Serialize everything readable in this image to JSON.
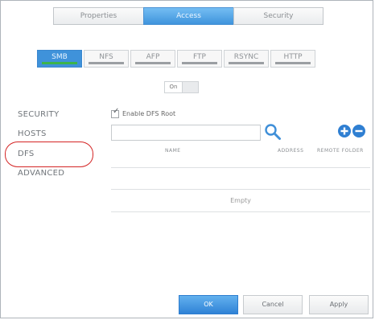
{
  "top_tabs": [
    {
      "label": "Properties",
      "active": false
    },
    {
      "label": "Access",
      "active": true
    },
    {
      "label": "Security",
      "active": false
    }
  ],
  "protocol_tabs": [
    {
      "label": "SMB",
      "active": true
    },
    {
      "label": "NFS",
      "active": false
    },
    {
      "label": "AFP",
      "active": false
    },
    {
      "label": "FTP",
      "active": false
    },
    {
      "label": "RSYNC",
      "active": false
    },
    {
      "label": "HTTP",
      "active": false
    }
  ],
  "toggle": {
    "label": "On",
    "state": "on"
  },
  "menu": [
    {
      "label": "SECURITY",
      "selected": false
    },
    {
      "label": "HOSTS",
      "selected": false
    },
    {
      "label": "DFS",
      "selected": true
    },
    {
      "label": "ADVANCED",
      "selected": false
    }
  ],
  "dfs": {
    "enable_label": "Enable DFS Root",
    "enable_checked": true,
    "search_value": "",
    "search_icon": "magnifier-icon",
    "add_icon": "plus-circle-icon",
    "remove_icon": "minus-circle-icon",
    "columns": [
      "NAME",
      "ADDRESS",
      "REMOTE FOLDER"
    ],
    "empty_text": "Empty"
  },
  "buttons": {
    "ok": "OK",
    "cancel": "Cancel",
    "apply": "Apply"
  },
  "colors": {
    "accent": "#3f92da",
    "active_indicator": "#3db44b",
    "highlight": "#d42525"
  }
}
